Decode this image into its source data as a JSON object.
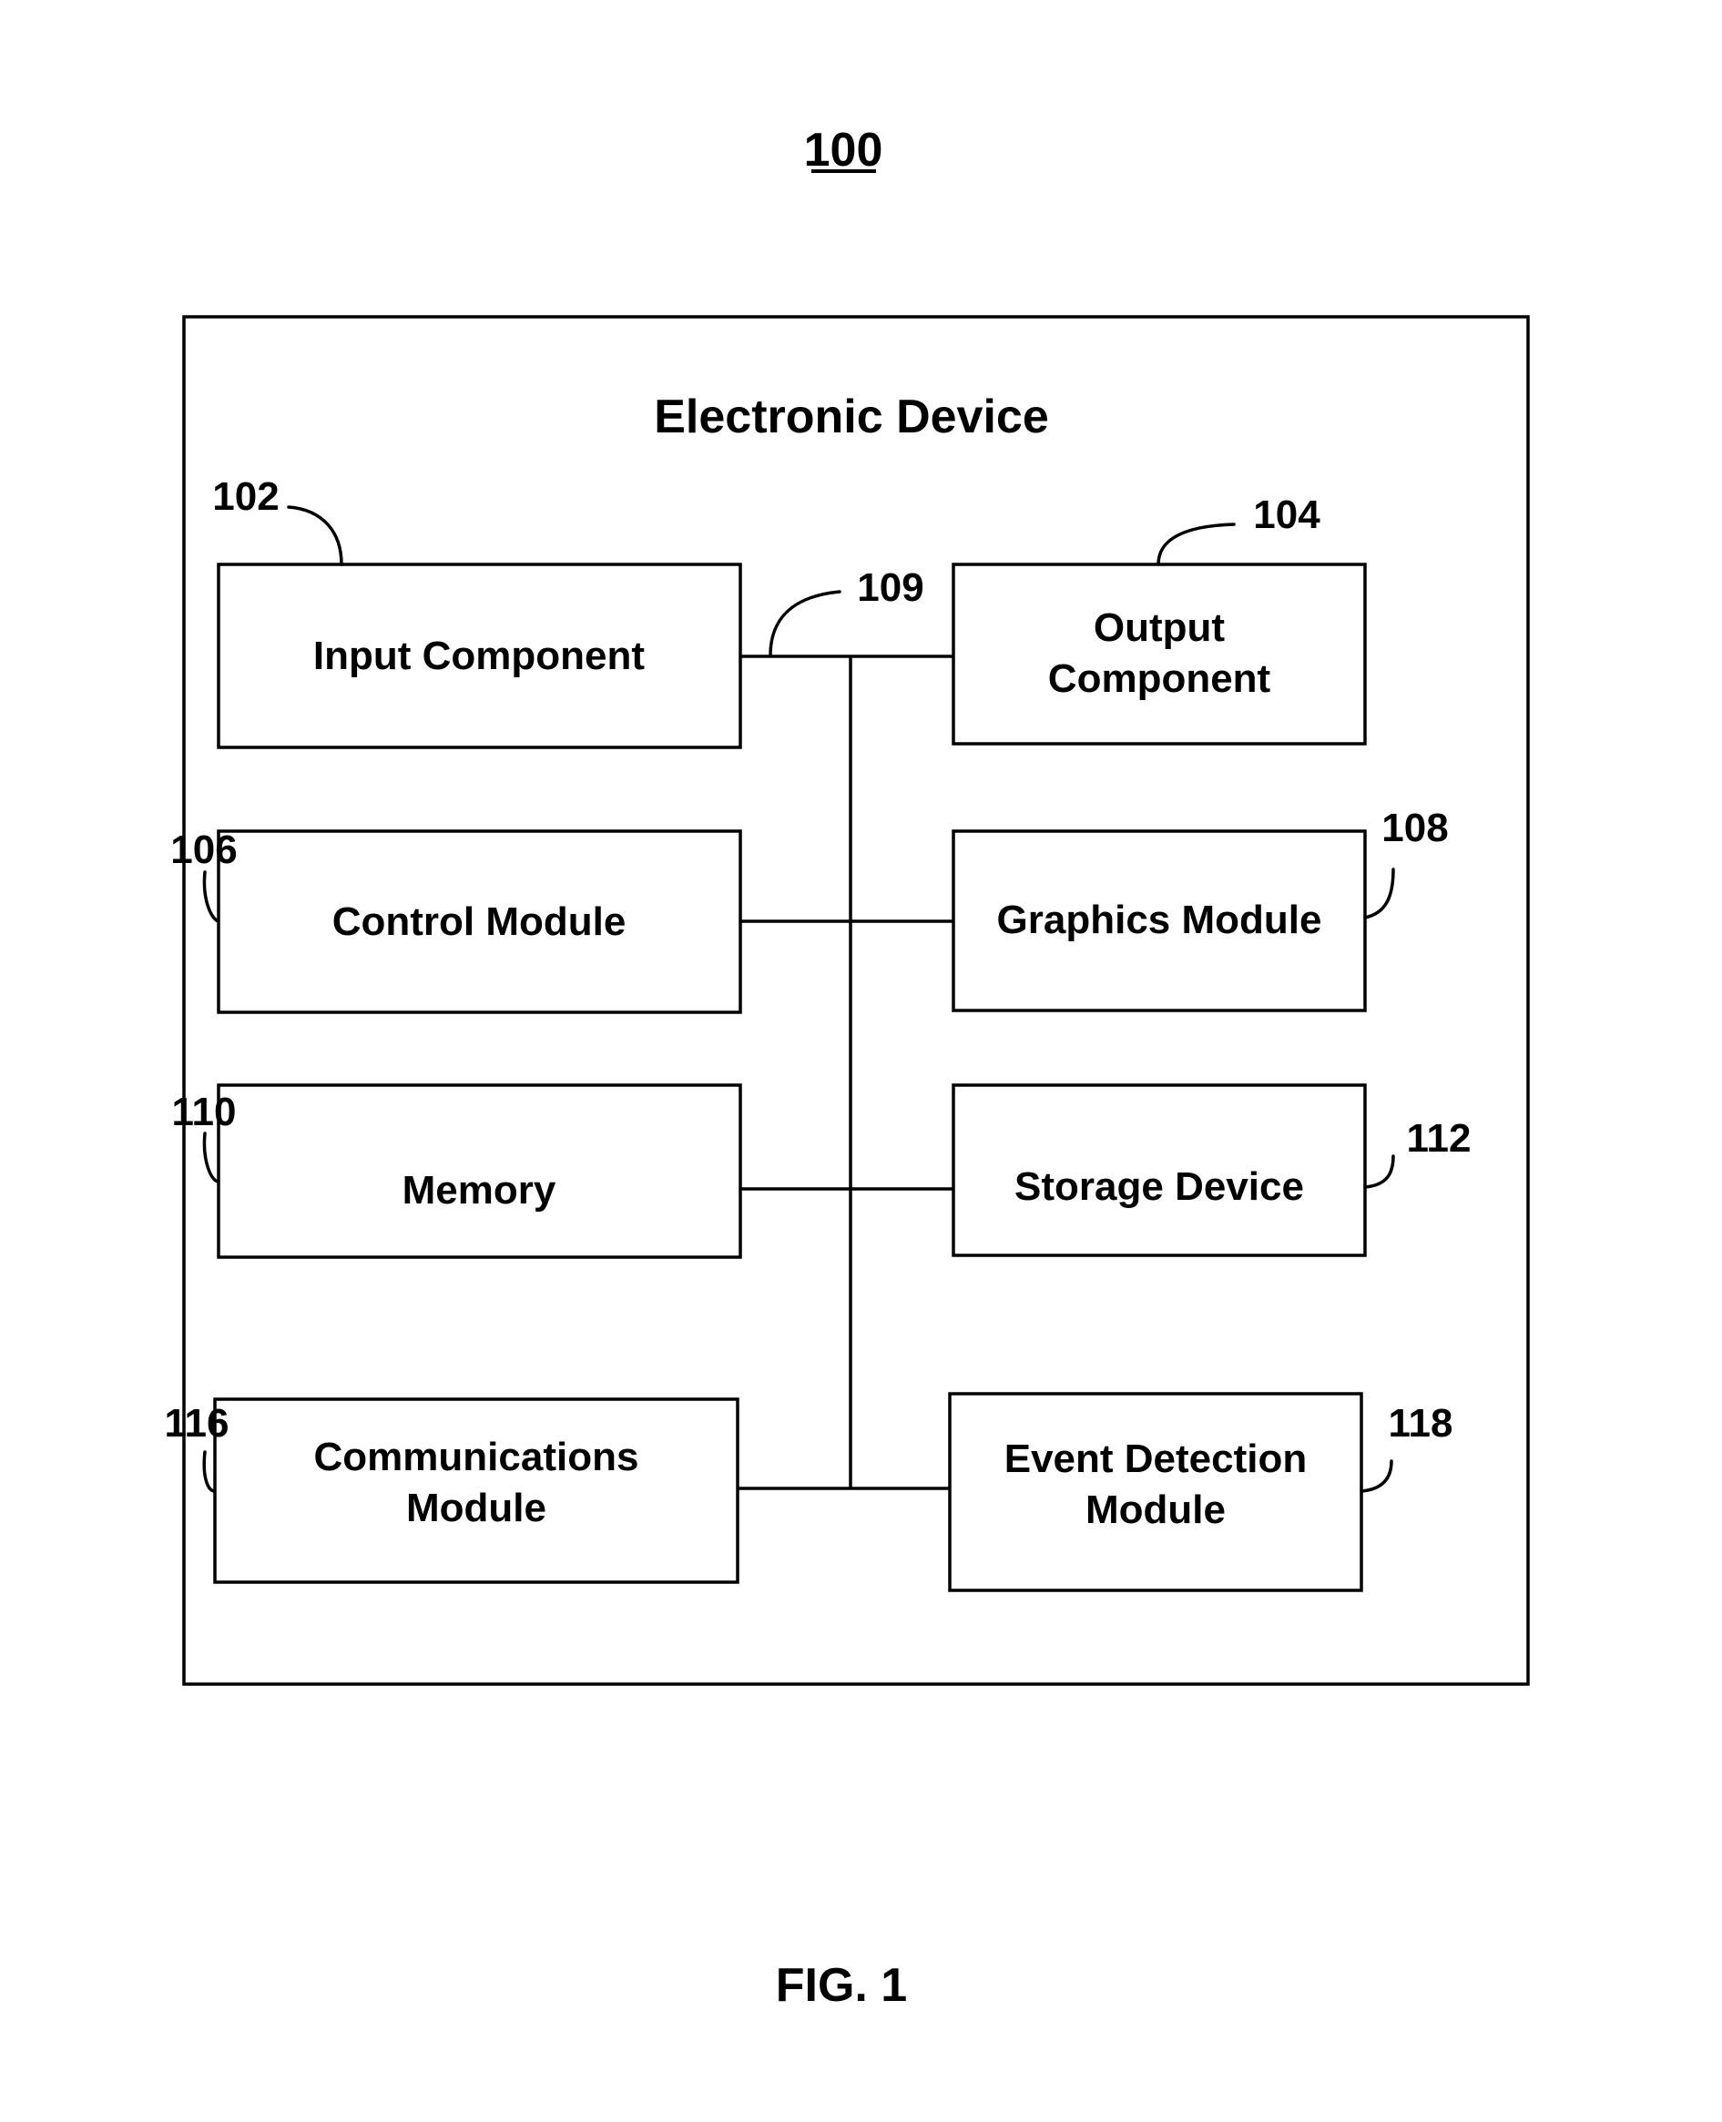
{
  "figure_ref": "100",
  "figure_caption": "FIG. 1",
  "device": {
    "title": "Electronic Device"
  },
  "bus": {
    "ref": "109"
  },
  "components": [
    {
      "id": "input",
      "ref": "102",
      "lines": [
        "Input Component"
      ]
    },
    {
      "id": "output",
      "ref": "104",
      "lines": [
        "Output",
        "Component"
      ]
    },
    {
      "id": "control",
      "ref": "106",
      "lines": [
        "Control Module"
      ]
    },
    {
      "id": "graphics",
      "ref": "108",
      "lines": [
        "Graphics Module"
      ]
    },
    {
      "id": "memory",
      "ref": "110",
      "lines": [
        "Memory"
      ]
    },
    {
      "id": "storage",
      "ref": "112",
      "lines": [
        "Storage Device"
      ]
    },
    {
      "id": "communications",
      "ref": "116",
      "lines": [
        "Communications",
        "Module"
      ]
    },
    {
      "id": "event-detection",
      "ref": "118",
      "lines": [
        "Event Detection",
        "Module"
      ]
    }
  ]
}
